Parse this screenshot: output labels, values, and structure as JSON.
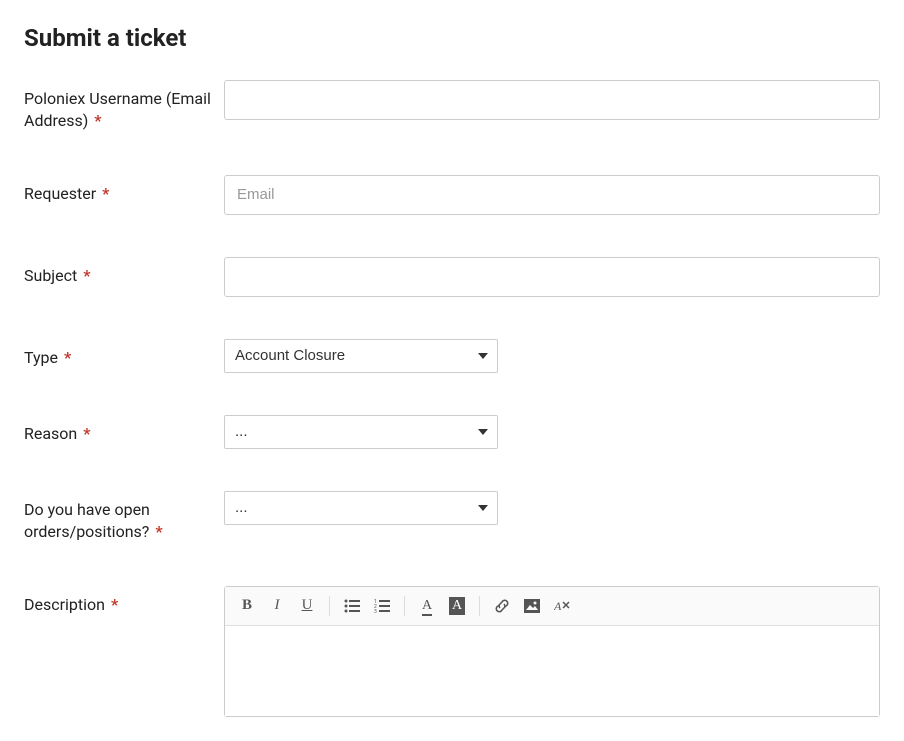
{
  "page_title": "Submit a ticket",
  "fields": {
    "username": {
      "label": "Poloniex Username (Email Address)",
      "value": "",
      "placeholder": ""
    },
    "requester": {
      "label": "Requester",
      "value": "",
      "placeholder": "Email"
    },
    "subject": {
      "label": "Subject",
      "value": "",
      "placeholder": ""
    },
    "type": {
      "label": "Type",
      "selected": "Account Closure"
    },
    "reason": {
      "label": "Reason",
      "selected": "..."
    },
    "open_orders": {
      "label": "Do you have open orders/positions?",
      "selected": "..."
    },
    "description": {
      "label": "Description"
    }
  },
  "required_marker": "*",
  "toolbar": {
    "bold": "B",
    "italic": "I",
    "underline": "U",
    "textcolor": "A",
    "bgcolor": "A"
  }
}
